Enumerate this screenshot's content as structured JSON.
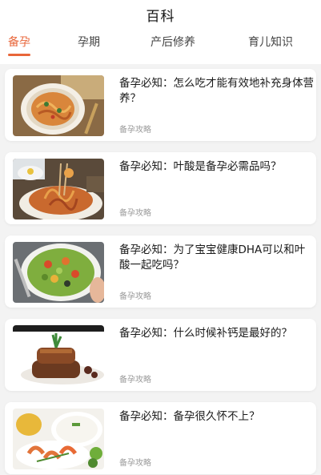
{
  "header": {
    "title": "百科"
  },
  "tabs": [
    {
      "label": "备孕",
      "active": true
    },
    {
      "label": "孕期",
      "active": false
    },
    {
      "label": "产后修养",
      "active": false
    },
    {
      "label": "育儿知识",
      "active": false
    }
  ],
  "accent_color": "#e8663a",
  "articles": [
    {
      "title": "备孕必知：怎么吃才能有效地补充身体营养？",
      "tag": "备孕攻略",
      "image": "pasta-plate-image"
    },
    {
      "title": "备孕必知：叶酸是备孕必需品吗？",
      "tag": "备孕攻略",
      "image": "fried-noodles-image"
    },
    {
      "title": "备孕必知：为了宝宝健康DHA可以和叶酸一起吃吗？",
      "tag": "备孕攻略",
      "image": "salad-bowl-image"
    },
    {
      "title": "备孕必知：什么时候补钙是最好的？",
      "tag": "备孕攻略",
      "image": "steak-dish-image"
    },
    {
      "title": "备孕必知：备孕很久怀不上？",
      "tag": "备孕攻略",
      "image": "shrimp-rice-image"
    }
  ]
}
